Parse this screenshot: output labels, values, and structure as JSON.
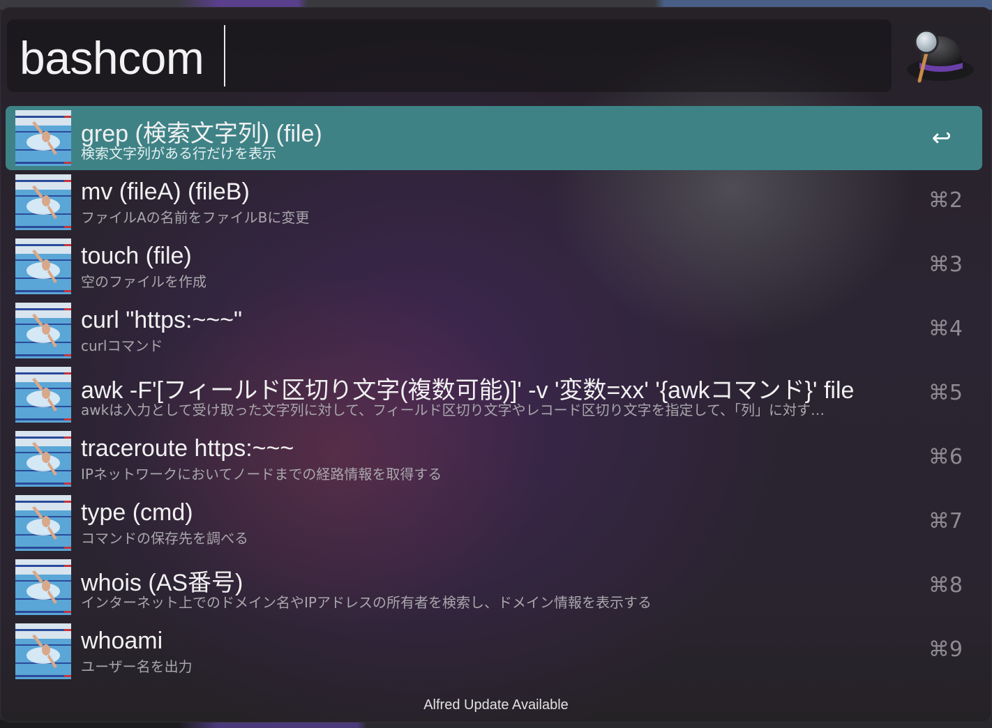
{
  "search": {
    "query": "bashcom"
  },
  "results": [
    {
      "title": "grep (検索文字列) (file)",
      "subtitle": "検索文字列がある行だけを表示",
      "shortcut": "↩",
      "selected": true
    },
    {
      "title": "mv (fileA) (fileB)",
      "subtitle": "ファイルAの名前をファイルBに変更",
      "shortcut": "⌘2"
    },
    {
      "title": "touch (file)",
      "subtitle": "空のファイルを作成",
      "shortcut": "⌘3"
    },
    {
      "title": "curl \"https:~~~\"",
      "subtitle": "curlコマンド",
      "shortcut": "⌘4"
    },
    {
      "title": "awk -F'[フィールド区切り文字(複数可能)]' -v '変数=xx' '{awkコマンド}' file",
      "subtitle": "awkは入力として受け取った文字列に対して、フィールド区切り文字やレコード区切り文字を指定して、「列」に対す…",
      "shortcut": "⌘5"
    },
    {
      "title": "traceroute https:~~~",
      "subtitle": "IPネットワークにおいてノードまでの経路情報を取得する",
      "shortcut": "⌘6"
    },
    {
      "title": "type (cmd)",
      "subtitle": "コマンドの保存先を調べる",
      "shortcut": "⌘7"
    },
    {
      "title": "whois (AS番号)",
      "subtitle": "インターネット上でのドメイン名やIPアドレスの所有者を検索し、ドメイン情報を表示する",
      "shortcut": "⌘8"
    },
    {
      "title": "whoami",
      "subtitle": "ユーザー名を出力",
      "shortcut": "⌘9"
    }
  ],
  "footer": {
    "text": "Alfred Update Available"
  },
  "colors": {
    "selected": "#3e8286",
    "panel": "#2a2430"
  }
}
